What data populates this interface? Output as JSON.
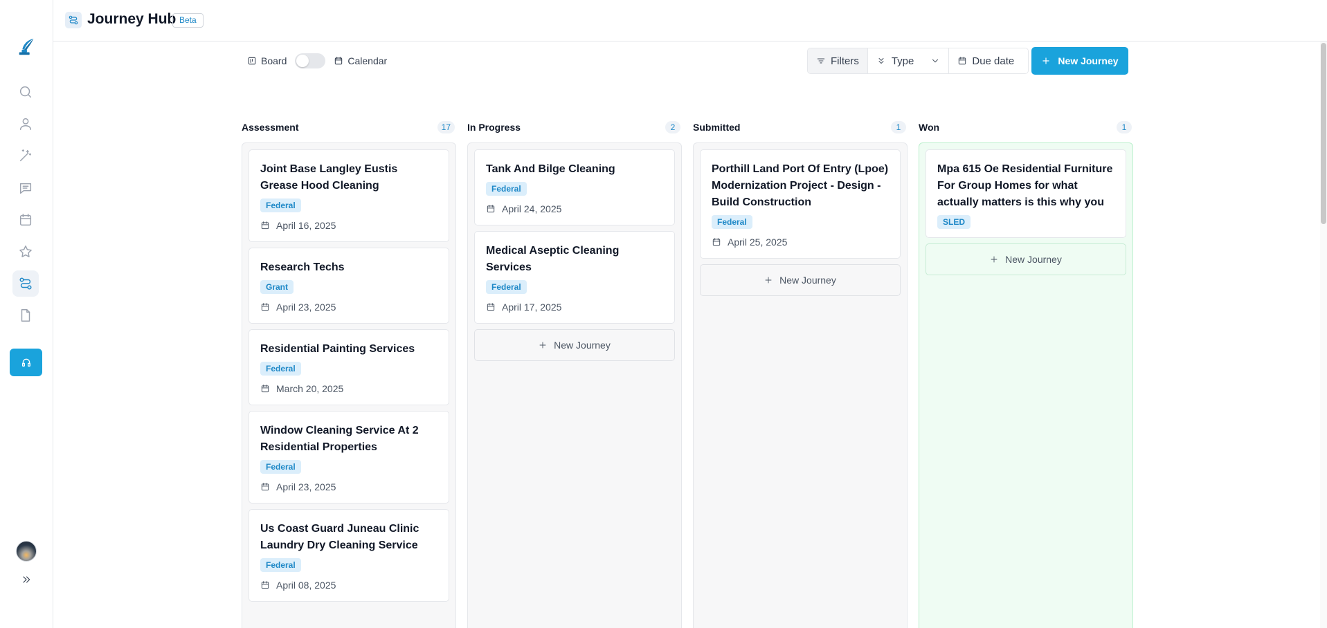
{
  "header": {
    "title": "Journey Hub",
    "badge": "Beta"
  },
  "sidebar": {
    "items": [
      {
        "name": "search-icon"
      },
      {
        "name": "user-icon"
      },
      {
        "name": "magic-wand-icon"
      },
      {
        "name": "chat-icon"
      },
      {
        "name": "calendar-icon"
      },
      {
        "name": "star-icon"
      },
      {
        "name": "journey-icon",
        "active": true
      },
      {
        "name": "document-icon"
      }
    ]
  },
  "toolbar": {
    "board_label": "Board",
    "calendar_label": "Calendar",
    "filters_label": "Filters",
    "type_label": "Type",
    "due_date_label": "Due date",
    "new_journey_label": "New Journey"
  },
  "columns": [
    {
      "title": "Assessment",
      "count": "17",
      "cards": [
        {
          "title": "Joint Base Langley Eustis Grease Hood Cleaning",
          "tag": "Federal",
          "date": "April 16, 2025"
        },
        {
          "title": "Research Techs",
          "tag": "Grant",
          "date": "April 23, 2025"
        },
        {
          "title": "Residential Painting Services",
          "tag": "Federal",
          "date": "March 20, 2025"
        },
        {
          "title": "Window Cleaning Service At 2 Residential Properties",
          "tag": "Federal",
          "date": "April 23, 2025"
        },
        {
          "title": "Us Coast Guard Juneau Clinic Laundry Dry Cleaning Service",
          "tag": "Federal",
          "date": "April 08, 2025"
        }
      ]
    },
    {
      "title": "In Progress",
      "count": "2",
      "cards": [
        {
          "title": "Tank And Bilge Cleaning",
          "tag": "Federal",
          "date": "April 24, 2025"
        },
        {
          "title": "Medical Aseptic Cleaning Services",
          "tag": "Federal",
          "date": "April 17, 2025"
        }
      ],
      "add_label": "New Journey"
    },
    {
      "title": "Submitted",
      "count": "1",
      "cards": [
        {
          "title": "Porthill Land Port Of Entry (Lpoe) Modernization Project - Design - Build Construction",
          "tag": "Federal",
          "date": "April 25, 2025"
        }
      ],
      "add_label": "New Journey"
    },
    {
      "title": "Won",
      "count": "1",
      "cards": [
        {
          "title": "Mpa 615 Oe Residential Furniture For Group Homes for what actually matters is this why you",
          "tag": "SLED"
        }
      ],
      "add_label": "New Journey"
    }
  ]
}
